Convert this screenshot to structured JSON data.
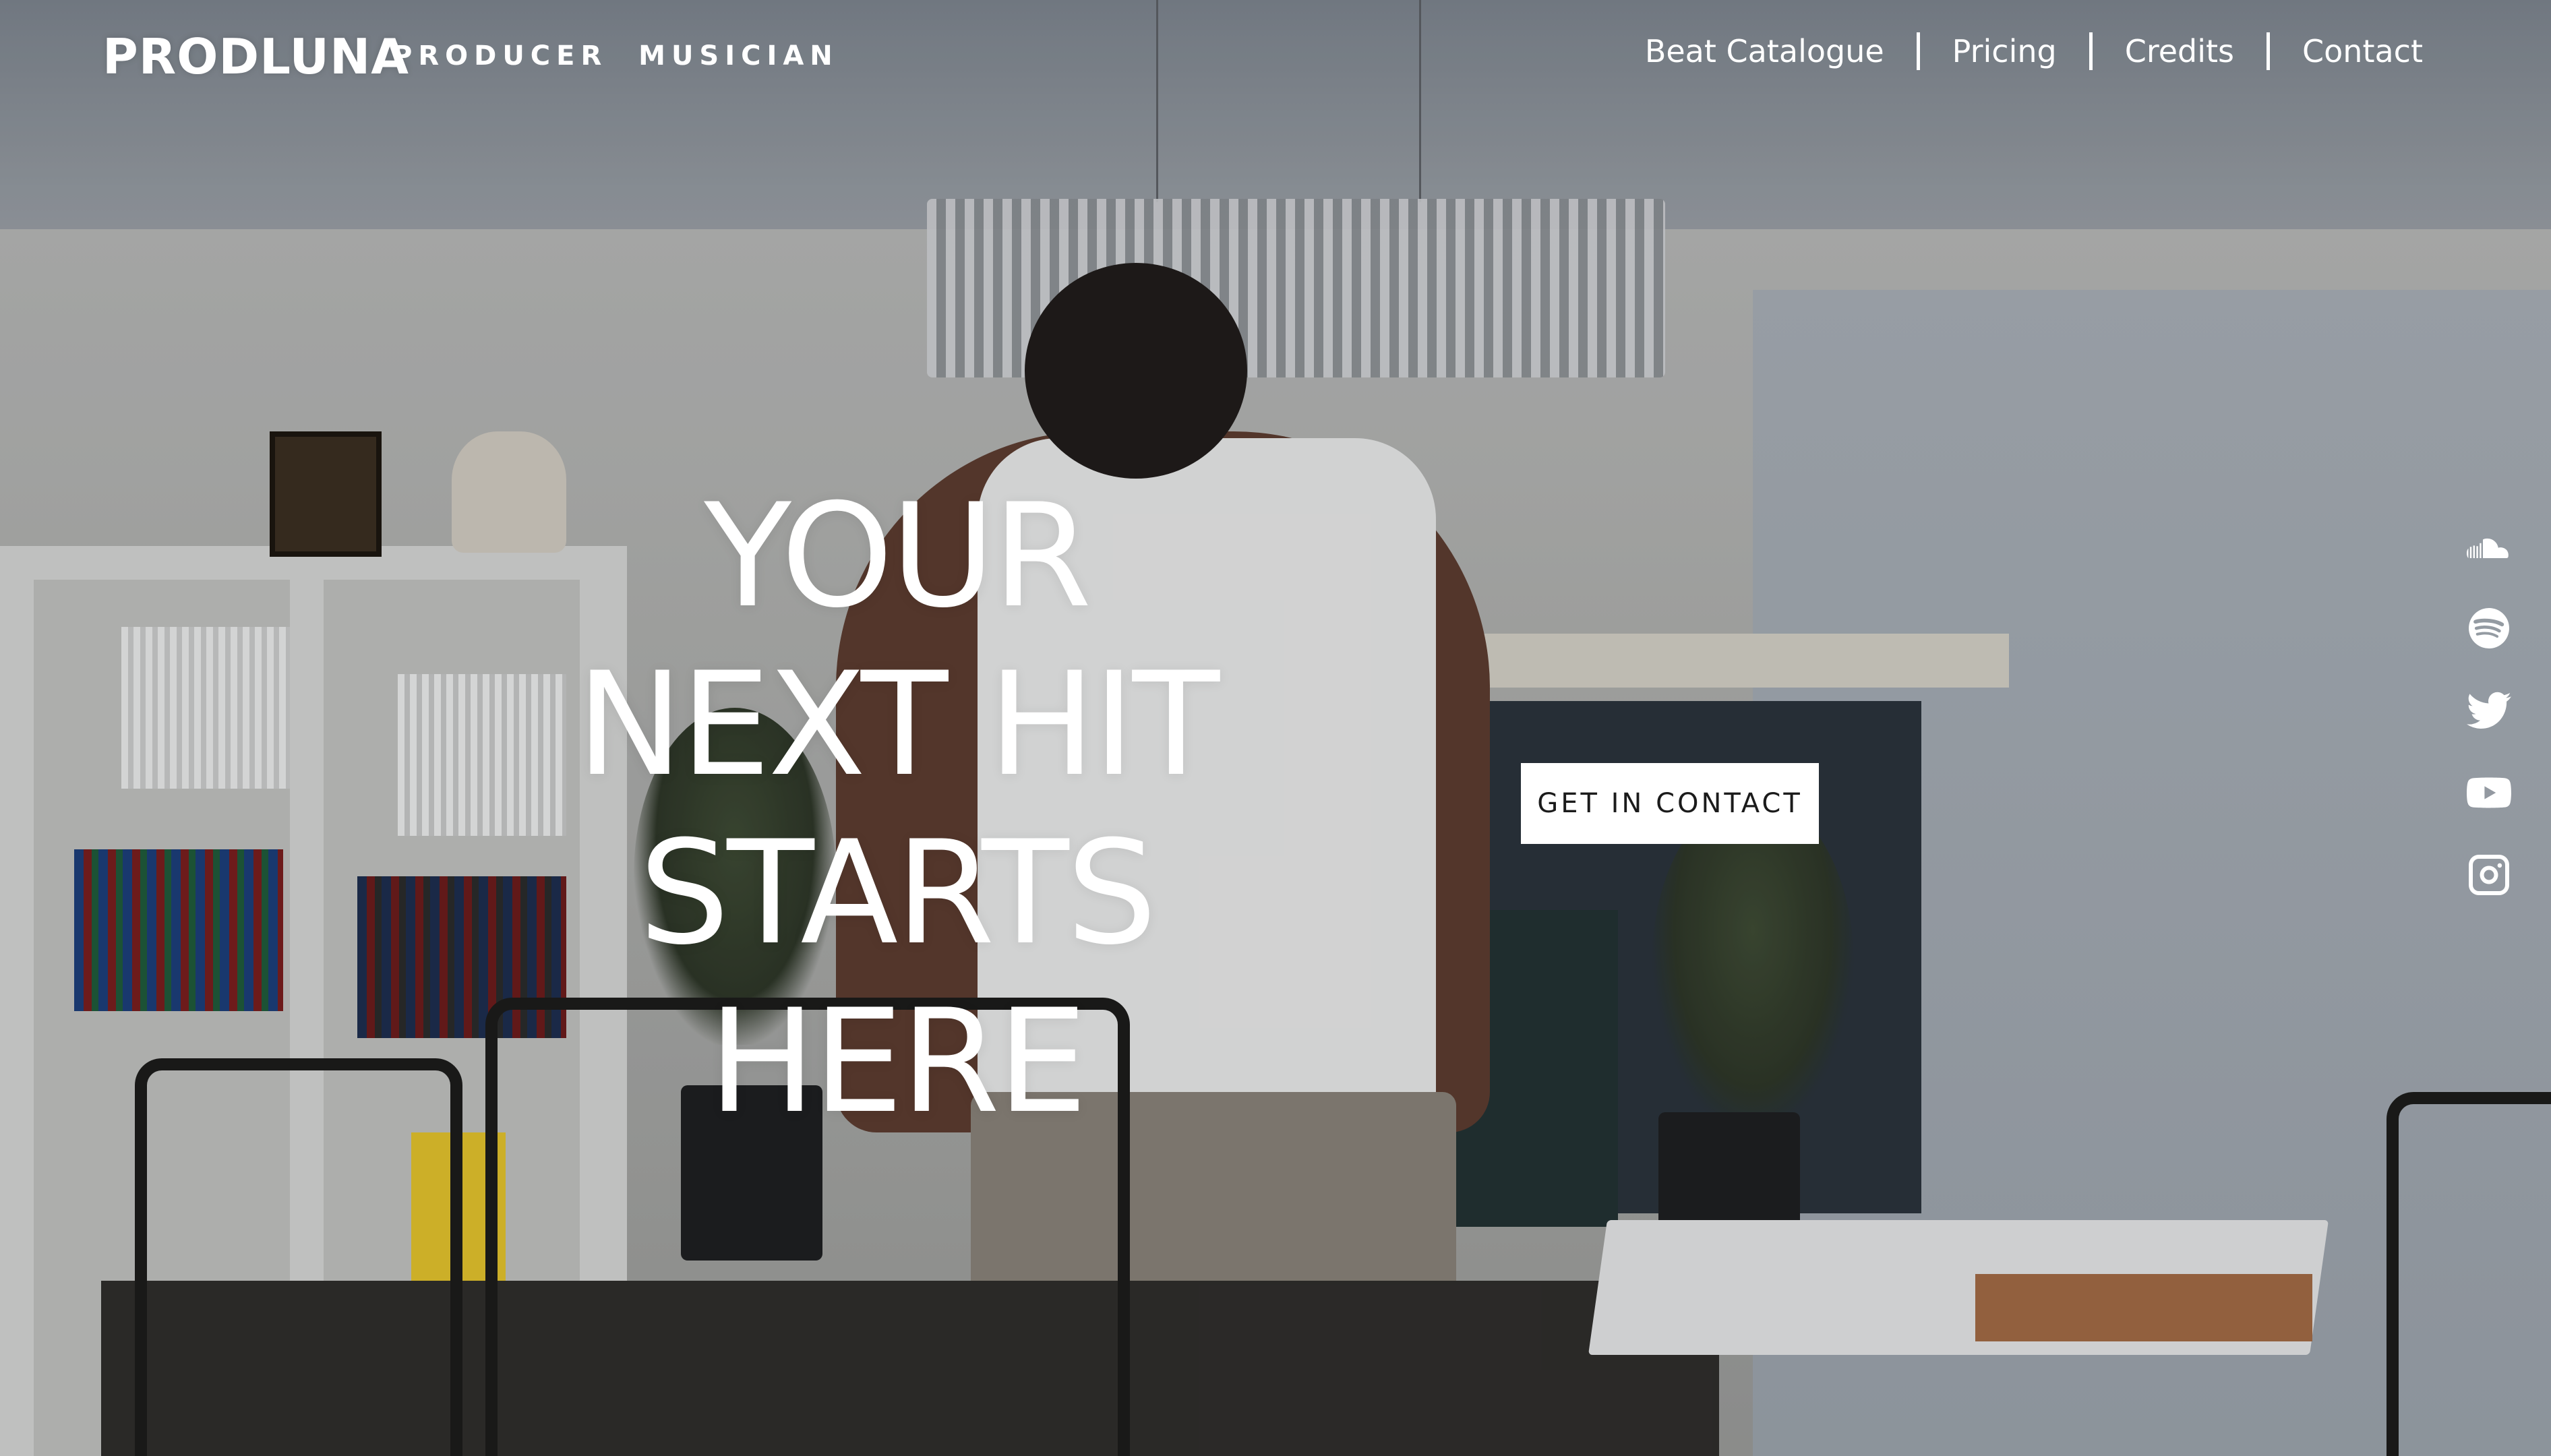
{
  "header": {
    "brand": "PRODLUNA",
    "tagline": "PRODUCER  MUSICIAN",
    "nav": [
      "Beat Catalogue",
      "Pricing",
      "Credits",
      "Contact"
    ]
  },
  "hero": {
    "headline_lines": [
      "YOUR",
      "NEXT HIT",
      "STARTS",
      "HERE"
    ],
    "cta_label": "GET IN CONTACT"
  },
  "social": [
    "soundcloud-icon",
    "spotify-icon",
    "twitter-icon",
    "youtube-icon",
    "instagram-icon"
  ]
}
